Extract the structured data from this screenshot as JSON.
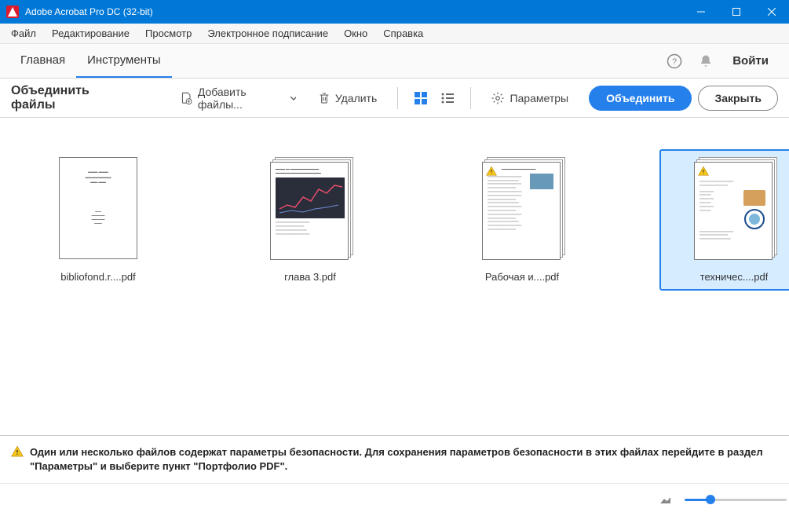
{
  "titlebar": {
    "title": "Adobe Acrobat Pro DC (32-bit)"
  },
  "menubar": [
    "Файл",
    "Редактирование",
    "Просмотр",
    "Электронное подписание",
    "Окно",
    "Справка"
  ],
  "topbar": {
    "tabs": [
      {
        "label": "Главная",
        "active": false
      },
      {
        "label": "Инструменты",
        "active": true
      }
    ],
    "signin": "Войти"
  },
  "toolbar": {
    "title": "Объединить файлы",
    "add_files": "Добавить файлы...",
    "delete": "Удалить",
    "options": "Параметры",
    "combine": "Объединить",
    "close": "Закрыть"
  },
  "files": [
    {
      "name": "bibliofond.r....pdf",
      "selected": false,
      "warn": false,
      "multi": false,
      "style": "title"
    },
    {
      "name": "глава 3.pdf",
      "selected": false,
      "warn": false,
      "multi": true,
      "style": "chart"
    },
    {
      "name": "Рабочая и....pdf",
      "selected": false,
      "warn": true,
      "multi": true,
      "style": "text"
    },
    {
      "name": "техничес....pdf",
      "selected": true,
      "warn": true,
      "multi": true,
      "style": "mixed"
    }
  ],
  "warning": "Один или несколько файлов содержат параметры безопасности. Для сохранения параметров безопасности в этих файлах перейдите в раздел \"Параметры\" и выберите пункт \"Портфолио PDF\".",
  "rail_icons": [
    "create-pdf-icon",
    "combine-files-icon",
    "organize-icon",
    "export-icon",
    "edit-icon",
    "request-sign-icon",
    "redact-icon",
    "stamp-icon",
    "comment-icon",
    "print-icon",
    "protect-icon"
  ],
  "rail_active_index": 1
}
